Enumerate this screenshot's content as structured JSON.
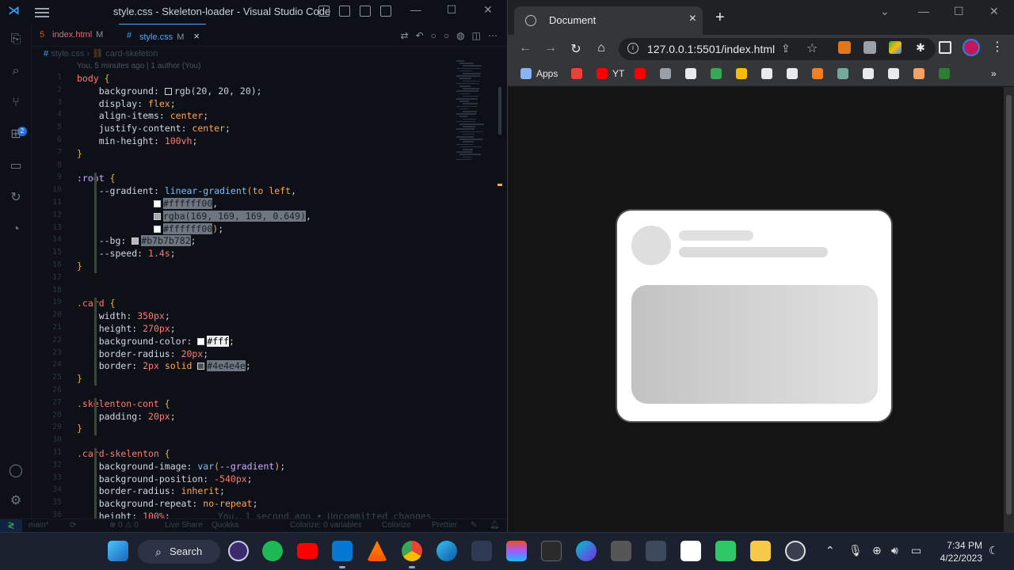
{
  "vscode": {
    "window_title": "style.css - Skeleton-loader - Visual Studio Code",
    "scm_badge": "2",
    "tabs": [
      {
        "icon": "5",
        "label": "index.html",
        "modifier": "M"
      },
      {
        "icon": "#",
        "label": "style.css",
        "modifier": "M",
        "close": "×"
      }
    ],
    "breadcrumb": {
      "file": "style.css",
      "symbol": "card-skeleton"
    },
    "blame": "You, 5 minutes ago | 1 author (You)",
    "code_lines": [
      {
        "n": "1",
        "segs": [
          [
            "sel",
            "body"
          ],
          [
            "",
            " "
          ],
          [
            "br",
            "{"
          ]
        ]
      },
      {
        "n": "2",
        "segs": [
          [
            "",
            "    "
          ],
          [
            "prop",
            "background"
          ],
          [
            "",
            ": "
          ],
          [
            "sw",
            "#141414"
          ],
          [
            "",
            "rgb(20, 20, 20)"
          ],
          [
            "",
            ";"
          ]
        ]
      },
      {
        "n": "3",
        "segs": [
          [
            "",
            "    "
          ],
          [
            "prop",
            "display"
          ],
          [
            "",
            ": "
          ],
          [
            "val",
            "flex"
          ],
          [
            "",
            ";"
          ]
        ]
      },
      {
        "n": "4",
        "segs": [
          [
            "",
            "    "
          ],
          [
            "prop",
            "align-items"
          ],
          [
            "",
            ": "
          ],
          [
            "val",
            "center"
          ],
          [
            "",
            ";"
          ]
        ]
      },
      {
        "n": "5",
        "segs": [
          [
            "",
            "    "
          ],
          [
            "prop",
            "justify-content"
          ],
          [
            "",
            ": "
          ],
          [
            "val",
            "center"
          ],
          [
            "",
            ";"
          ]
        ]
      },
      {
        "n": "6",
        "segs": [
          [
            "",
            "    "
          ],
          [
            "prop",
            "min-height"
          ],
          [
            "",
            ": "
          ],
          [
            "num",
            "100vh"
          ],
          [
            "",
            ";"
          ]
        ]
      },
      {
        "n": "7",
        "segs": [
          [
            "br",
            "}"
          ]
        ]
      },
      {
        "n": "8",
        "segs": []
      },
      {
        "n": "9",
        "segs": [
          [
            "var",
            ":root"
          ],
          [
            "",
            " "
          ],
          [
            "br",
            "{"
          ]
        ]
      },
      {
        "n": "10",
        "segs": [
          [
            "",
            "    "
          ],
          [
            "prop",
            "--gradient"
          ],
          [
            "",
            ": "
          ],
          [
            "fn",
            "linear-gradient"
          ],
          [
            "br",
            "("
          ],
          [
            "val",
            "to left"
          ],
          [
            "",
            ","
          ]
        ]
      },
      {
        "n": "11",
        "segs": [
          [
            "",
            "              "
          ],
          [
            "sw",
            "#ffffff"
          ],
          [
            "hl",
            "#ffffff00"
          ],
          [
            "",
            ","
          ]
        ]
      },
      {
        "n": "12",
        "segs": [
          [
            "",
            "              "
          ],
          [
            "sw",
            "#a9a9a9"
          ],
          [
            "hl",
            "rgba(169, 169, 169, 0.649)"
          ],
          [
            "",
            ","
          ]
        ]
      },
      {
        "n": "13",
        "segs": [
          [
            "",
            "              "
          ],
          [
            "sw",
            "#ffffff"
          ],
          [
            "hl",
            "#ffffff00"
          ],
          [
            "br",
            ")"
          ],
          [
            "",
            ";"
          ]
        ]
      },
      {
        "n": "14",
        "segs": [
          [
            "",
            "    "
          ],
          [
            "prop",
            "--bg"
          ],
          [
            "",
            ": "
          ],
          [
            "sw",
            "#b7b7b7"
          ],
          [
            "hl",
            "#b7b7b782"
          ],
          [
            "",
            ";"
          ]
        ]
      },
      {
        "n": "15",
        "segs": [
          [
            "",
            "    "
          ],
          [
            "prop",
            "--speed"
          ],
          [
            "",
            ": "
          ],
          [
            "num",
            "1.4s"
          ],
          [
            "",
            ";"
          ]
        ]
      },
      {
        "n": "16",
        "segs": [
          [
            "br",
            "}"
          ]
        ]
      },
      {
        "n": "17",
        "segs": []
      },
      {
        "n": "18",
        "segs": []
      },
      {
        "n": "19",
        "segs": [
          [
            "sel",
            ".card"
          ],
          [
            "",
            " "
          ],
          [
            "br",
            "{"
          ]
        ]
      },
      {
        "n": "20",
        "segs": [
          [
            "",
            "    "
          ],
          [
            "prop",
            "width"
          ],
          [
            "",
            ": "
          ],
          [
            "num",
            "350px"
          ],
          [
            "",
            ";"
          ]
        ]
      },
      {
        "n": "21",
        "segs": [
          [
            "",
            "    "
          ],
          [
            "prop",
            "height"
          ],
          [
            "",
            ": "
          ],
          [
            "num",
            "270px"
          ],
          [
            "",
            ";"
          ]
        ]
      },
      {
        "n": "22",
        "segs": [
          [
            "",
            "    "
          ],
          [
            "prop",
            "background-color"
          ],
          [
            "",
            ": "
          ],
          [
            "sw",
            "#ffffff"
          ],
          [
            "hlw",
            "#fff"
          ],
          [
            "",
            ";"
          ]
        ]
      },
      {
        "n": "23",
        "segs": [
          [
            "",
            "    "
          ],
          [
            "prop",
            "border-radius"
          ],
          [
            "",
            ": "
          ],
          [
            "num",
            "20px"
          ],
          [
            "",
            ";"
          ]
        ]
      },
      {
        "n": "24",
        "segs": [
          [
            "",
            "    "
          ],
          [
            "prop",
            "border"
          ],
          [
            "",
            ": "
          ],
          [
            "num",
            "2px"
          ],
          [
            "",
            ""
          ],
          [
            "val",
            " solid "
          ],
          [
            "sw",
            "#4e4e4e"
          ],
          [
            "hl",
            "#4e4e4e"
          ],
          [
            "",
            ";"
          ]
        ]
      },
      {
        "n": "25",
        "segs": [
          [
            "br",
            "}"
          ]
        ]
      },
      {
        "n": "26",
        "segs": []
      },
      {
        "n": "27",
        "segs": [
          [
            "sel",
            ".skelenton-cont"
          ],
          [
            "",
            " "
          ],
          [
            "br",
            "{"
          ]
        ]
      },
      {
        "n": "28",
        "segs": [
          [
            "",
            "    "
          ],
          [
            "prop",
            "padding"
          ],
          [
            "",
            ": "
          ],
          [
            "num",
            "20px"
          ],
          [
            "",
            ";"
          ]
        ]
      },
      {
        "n": "29",
        "segs": [
          [
            "br",
            "}"
          ]
        ]
      },
      {
        "n": "30",
        "segs": []
      },
      {
        "n": "31",
        "segs": [
          [
            "sel",
            ".card-skelenton"
          ],
          [
            "",
            " "
          ],
          [
            "br",
            "{"
          ]
        ]
      },
      {
        "n": "32",
        "segs": [
          [
            "",
            "    "
          ],
          [
            "prop",
            "background-image"
          ],
          [
            "",
            ": "
          ],
          [
            "fn",
            "var"
          ],
          [
            "br",
            "("
          ],
          [
            "var",
            "--gradient"
          ],
          [
            "br",
            ")"
          ],
          [
            "",
            ";"
          ]
        ]
      },
      {
        "n": "33",
        "segs": [
          [
            "",
            "    "
          ],
          [
            "prop",
            "background-position"
          ],
          [
            "",
            ": "
          ],
          [
            "num",
            "-540px"
          ],
          [
            "",
            ";"
          ]
        ]
      },
      {
        "n": "34",
        "segs": [
          [
            "",
            "    "
          ],
          [
            "prop",
            "border-radius"
          ],
          [
            "",
            ": "
          ],
          [
            "val",
            "inherit"
          ],
          [
            "",
            ";"
          ]
        ]
      },
      {
        "n": "35",
        "segs": [
          [
            "",
            "    "
          ],
          [
            "prop",
            "background-repeat"
          ],
          [
            "",
            ": "
          ],
          [
            "val",
            "no-repeat"
          ],
          [
            "",
            ";"
          ]
        ]
      },
      {
        "n": "36",
        "segs": [
          [
            "",
            "    "
          ],
          [
            "prop",
            "height"
          ],
          [
            "",
            ": "
          ],
          [
            "num",
            "100%"
          ],
          [
            "",
            ";"
          ]
        ]
      }
    ],
    "inline_blame": "You, 1 second ago • Uncommitted changes",
    "status": {
      "branch": "main*",
      "problems": "⊗ 0 ⚠ 0",
      "live_share": "Live Share",
      "quokka": "Quokka",
      "colorize_vars": "Colorize: 0 variables",
      "colorize": "Colorize",
      "prettier": "Prettier"
    }
  },
  "browser": {
    "tab_title": "Document",
    "tab_close": "×",
    "new_tab": "+",
    "url": "127.0.0.1:5501/index.html",
    "bookmarks": [
      {
        "label": "Apps",
        "color": "#8ab4f8"
      },
      {
        "label": "",
        "color": "#ea4335"
      },
      {
        "label": "YT",
        "color": "#ff0000"
      },
      {
        "label": "",
        "color": "#ff0000"
      },
      {
        "label": "",
        "color": "#9aa0a6"
      },
      {
        "label": "",
        "color": "#e8eaed"
      },
      {
        "label": "",
        "color": "#34a853"
      },
      {
        "label": "",
        "color": "#fbbc04"
      },
      {
        "label": "",
        "color": "#e8eaed"
      },
      {
        "label": "",
        "color": "#e8eaed"
      },
      {
        "label": "",
        "color": "#f48024"
      },
      {
        "label": "",
        "color": "#74aa9c"
      },
      {
        "label": "",
        "color": "#e8eaed"
      },
      {
        "label": "",
        "color": "#e8eaed"
      },
      {
        "label": "",
        "color": "#f4a261"
      },
      {
        "label": "",
        "color": "#2e7d32"
      }
    ],
    "more": "»"
  },
  "taskbar": {
    "search_label": "Search",
    "time": "7:34 PM",
    "date": "4/22/2023"
  },
  "colors": {
    "accent": "#1f6feb",
    "card_border": "#4e4e4e",
    "page_bg": "#141414"
  }
}
